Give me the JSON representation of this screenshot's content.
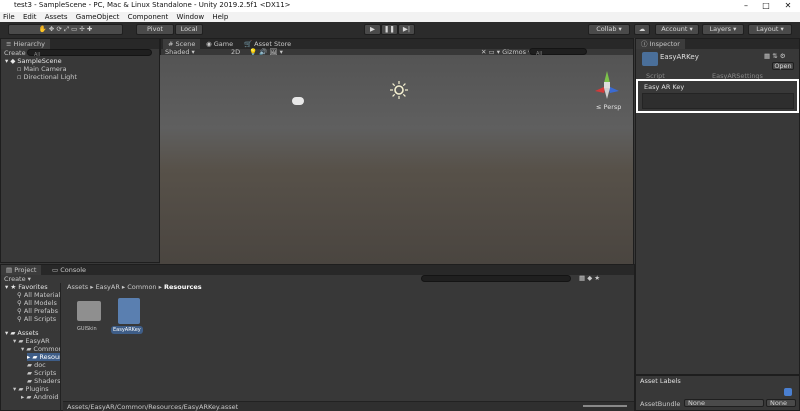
{
  "window": {
    "title": "test3 - SampleScene - PC, Mac & Linux Standalone - Unity 2019.2.5f1 <DX11>"
  },
  "menu": [
    "File",
    "Edit",
    "Assets",
    "GameObject",
    "Component",
    "Window",
    "Help"
  ],
  "toolbar": {
    "pivot": "Pivot",
    "local": "Local",
    "collab": "Collab",
    "account": "Account",
    "layers": "Layers",
    "layout": "Layout"
  },
  "hierarchy": {
    "tab": "Hierarchy",
    "create": "Create",
    "search_placeholder": "All",
    "scene": "SampleScene",
    "items": [
      "Main Camera",
      "Directional Light"
    ]
  },
  "scene_view": {
    "tabs": [
      "Scene",
      "Game",
      "Asset Store"
    ],
    "shading": "Shaded",
    "mode2d": "2D",
    "gizmos": "Gizmos",
    "search_placeholder": "All",
    "persp": "Persp"
  },
  "inspector": {
    "tab": "Inspector",
    "asset_name": "EasyARKey",
    "open": "Open",
    "script_label": "Script",
    "script_value": "EasyARSettings",
    "section": "Easy AR Key",
    "asset_labels": "Asset Labels",
    "assetbundle_label": "AssetBundle",
    "assetbundle_value": "None",
    "variant_value": "None"
  },
  "project": {
    "tabs": [
      "Project",
      "Console"
    ],
    "create": "Create",
    "breadcrumb": [
      "Assets",
      "EasyAR",
      "Common",
      "Resources"
    ],
    "favorites": "Favorites",
    "favorite_items": [
      "All Materials",
      "All Models",
      "All Prefabs",
      "All Scripts"
    ],
    "tree": [
      "Assets",
      "EasyAR",
      "Common",
      "Resources",
      "doc",
      "Scripts",
      "Shaders",
      "Plugins",
      "Android"
    ],
    "files": [
      {
        "name": "GUISkin"
      },
      {
        "name": "EasyARKey"
      }
    ],
    "status_path": "Assets/EasyAR/Common/Resources/EasyARKey.asset"
  }
}
